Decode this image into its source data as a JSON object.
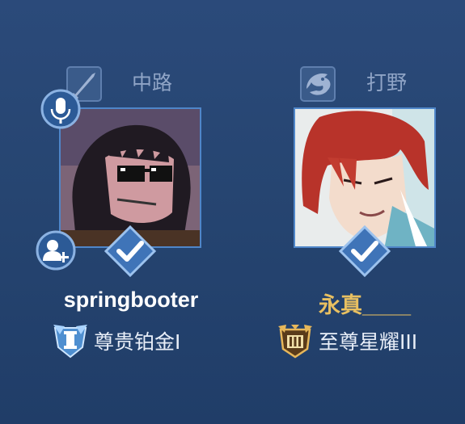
{
  "players": [
    {
      "role_label": "中路",
      "role_icon": "sword-icon",
      "name": "springbooter",
      "name_color": "#ffffff",
      "rank": "尊贵铂金I",
      "rank_icon": "platinum-badge-icon",
      "has_mic": true,
      "has_add_friend": true,
      "ready": true
    },
    {
      "role_label": "打野",
      "role_icon": "dragon-icon",
      "name": "永真____",
      "name_color": "#e8c061",
      "rank": "至尊星耀III",
      "rank_icon": "starshine-badge-icon",
      "has_mic": false,
      "has_add_friend": false,
      "ready": true
    }
  ],
  "colors": {
    "background": "#264571",
    "accent": "#4f86c9",
    "role_label": "#8fa4c6"
  }
}
